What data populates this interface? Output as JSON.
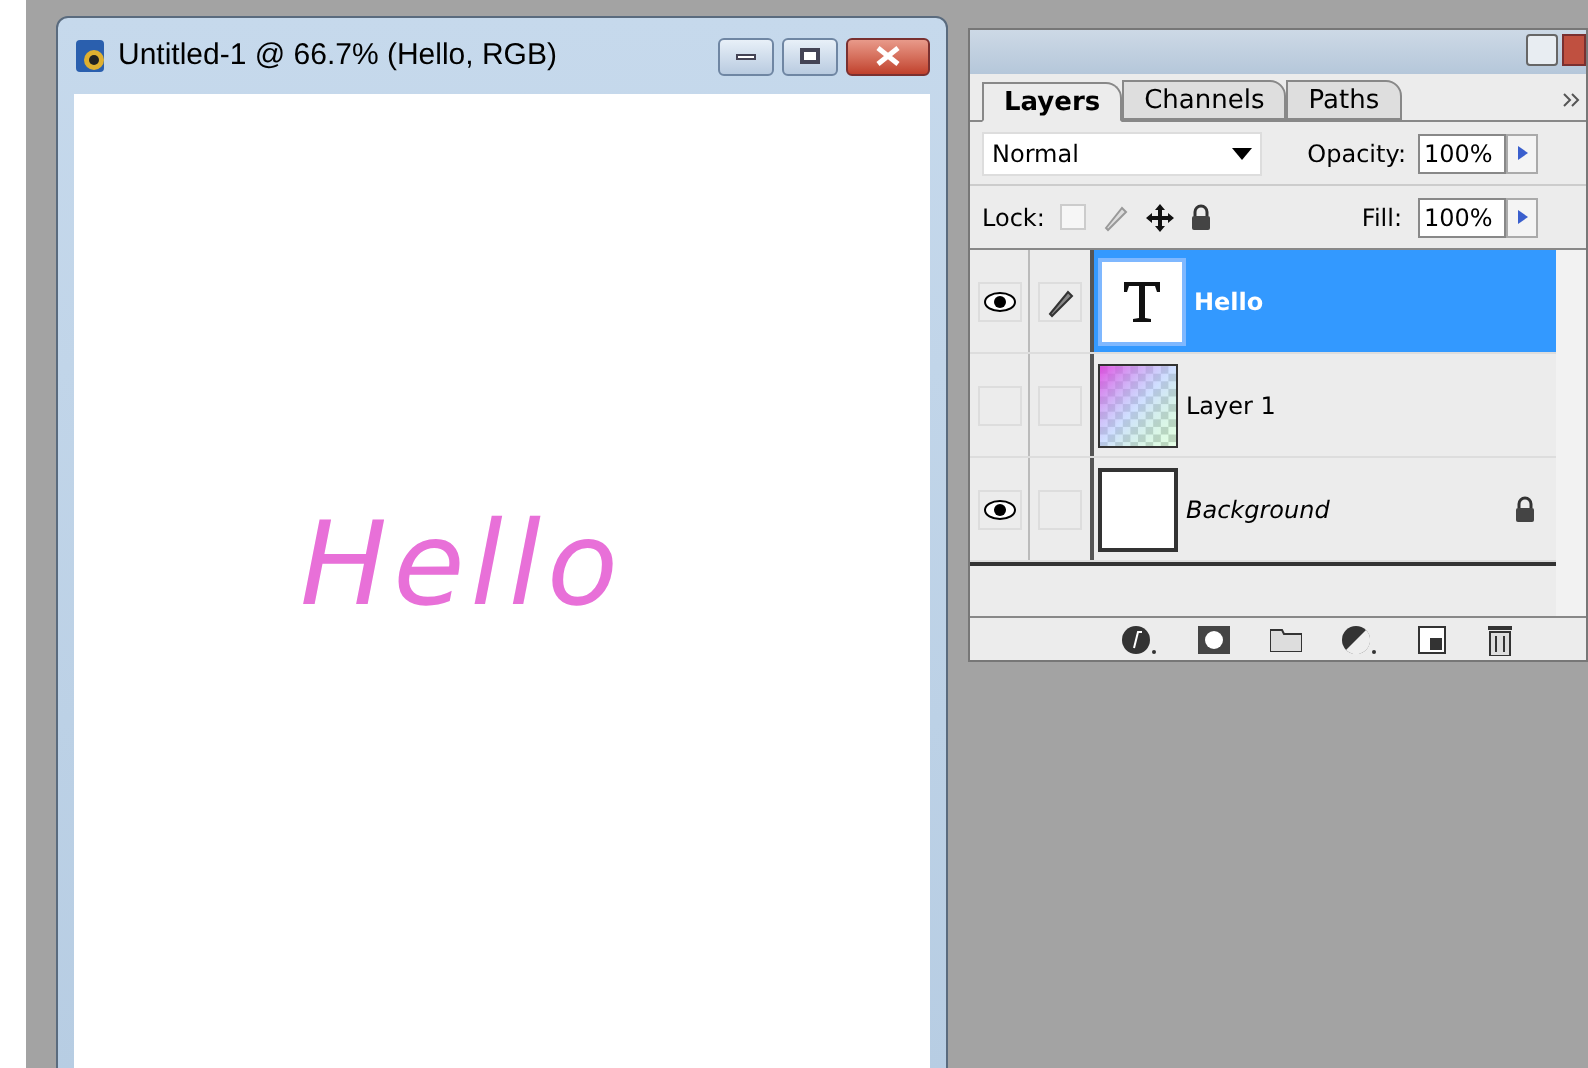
{
  "document": {
    "title": "Untitled-1 @ 66.7% (Hello, RGB)",
    "canvas_text": "Hello"
  },
  "panel": {
    "tabs": [
      {
        "label": "Layers",
        "selected": true
      },
      {
        "label": "Channels",
        "selected": false
      },
      {
        "label": "Paths",
        "selected": false
      }
    ],
    "blend_mode": "Normal",
    "opacity_label": "Opacity:",
    "opacity": "100%",
    "lock_label": "Lock:",
    "fill_label": "Fill:",
    "fill": "100%",
    "layers": [
      {
        "name": "Hello",
        "kind": "text",
        "visible": true,
        "linked": true,
        "selected": true,
        "locked": false
      },
      {
        "name": "Layer 1",
        "kind": "pixel",
        "visible": false,
        "linked": false,
        "selected": false,
        "locked": false
      },
      {
        "name": "Background",
        "kind": "background",
        "visible": true,
        "linked": false,
        "selected": false,
        "locked": true
      }
    ]
  }
}
